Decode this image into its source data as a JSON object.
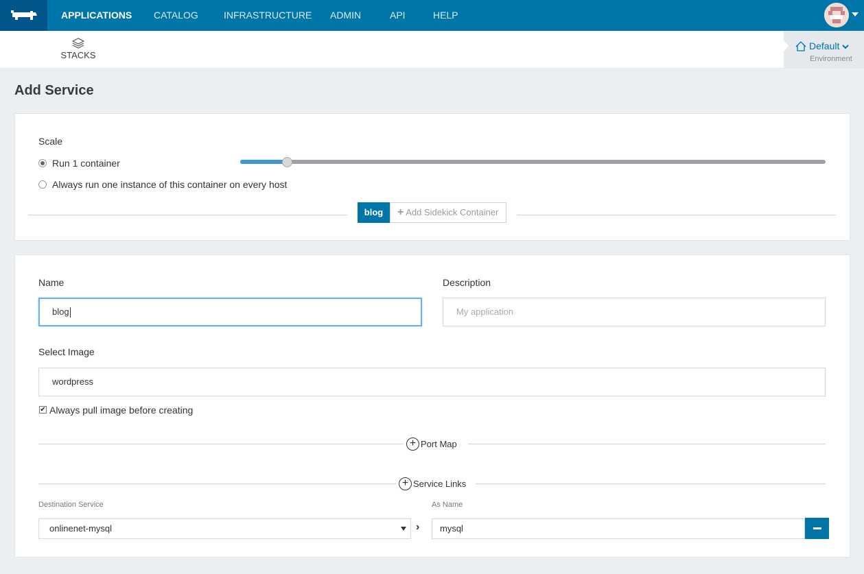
{
  "nav": {
    "items": [
      "APPLICATIONS",
      "CATALOG",
      "INFRASTRUCTURE",
      "ADMIN",
      "API",
      "HELP"
    ],
    "active": "APPLICATIONS",
    "brand_color": "#0075a8"
  },
  "subnav": {
    "stacks_label": "STACKS"
  },
  "environment": {
    "name": "Default",
    "label": "Environment"
  },
  "page": {
    "title": "Add Service"
  },
  "scale": {
    "label": "Scale",
    "option_run": "Run 1 container",
    "option_always": "Always run one instance of this container on every host",
    "selected": "Run 1 container",
    "slider_value": 1
  },
  "tabs": {
    "active_label": "blog",
    "add_sidekick_label": "Add Sidekick Container"
  },
  "form": {
    "name_label": "Name",
    "name_value": "blog",
    "description_label": "Description",
    "description_placeholder": "My application",
    "image_label": "Select Image",
    "image_value": "wordpress",
    "pull_label": "Always pull image before creating",
    "pull_checked": true,
    "port_map_label": "Port Map",
    "service_links_label": "Service Links",
    "dest_service_label": "Destination Service",
    "as_name_label": "As Name",
    "dest_service_value": "onlinenet-mysql",
    "as_name_value": "mysql"
  }
}
